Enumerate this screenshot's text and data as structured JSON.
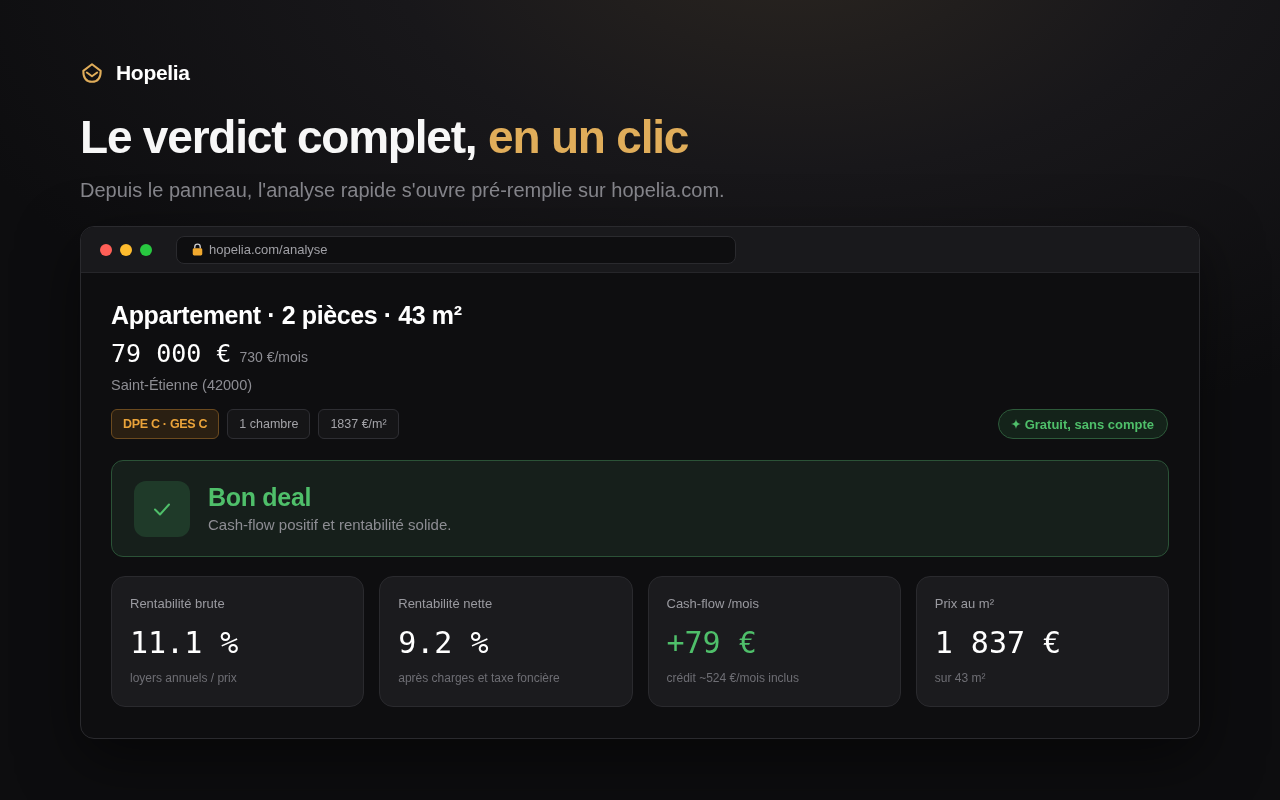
{
  "brand": {
    "name": "Hopelia"
  },
  "headline": {
    "text": "Le verdict complet,",
    "accent": "en un clic"
  },
  "subtitle": "Depuis le panneau, l'analyse rapide s'ouvre pré-remplie sur hopelia.com.",
  "browser": {
    "url": "hopelia.com/analyse"
  },
  "listing": {
    "title": "Appartement · 2 pièces · 43 m²",
    "price": "79 000 €",
    "rent": "730 €/mois",
    "location": "Saint-Étienne (42000)",
    "tags": [
      {
        "label": "DPE C · GES C",
        "kind": "energy"
      },
      {
        "label": "1 chambre",
        "kind": "plain"
      },
      {
        "label": "1837 €/m²",
        "kind": "plain"
      }
    ],
    "badge": "Gratuit, sans compte"
  },
  "verdict": {
    "title": "Bon deal",
    "text": "Cash-flow positif et rentabilité solide."
  },
  "metrics": [
    {
      "label": "Rentabilité brute",
      "value": "11.1 %",
      "note": "loyers annuels / prix",
      "kind": "plain"
    },
    {
      "label": "Rentabilité nette",
      "value": "9.2 %",
      "note": "après charges et taxe foncière",
      "kind": "plain"
    },
    {
      "label": "Cash-flow /mois",
      "value": "+79 €",
      "note": "crédit ~524 €/mois inclus",
      "kind": "positive"
    },
    {
      "label": "Prix au m²",
      "value": "1 837 €",
      "note": "sur 43 m²",
      "kind": "plain"
    }
  ]
}
